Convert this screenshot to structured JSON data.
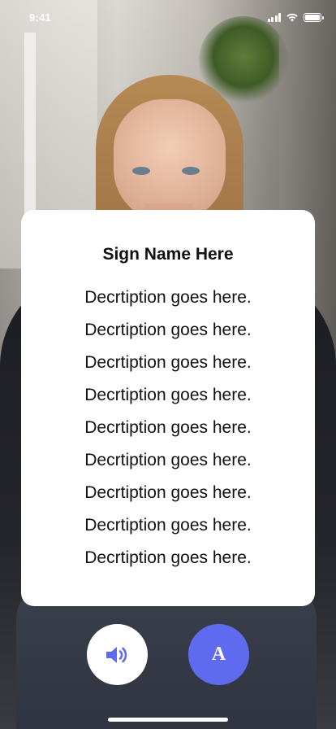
{
  "status_bar": {
    "time": "9:41"
  },
  "card": {
    "title": "Sign Name Here",
    "lines": [
      "Decrtiption goes here.",
      "Decrtiption goes here.",
      "Decrtiption goes here.",
      "Decrtiption goes here.",
      "Decrtiption goes here.",
      "Decrtiption goes here.",
      "Decrtiption goes here.",
      "Decrtiption goes here.",
      "Decrtiption goes here."
    ]
  },
  "buttons": {
    "sound_icon": "speaker-icon",
    "font_label": "A"
  },
  "colors": {
    "accent": "#5f6bef",
    "card_bg": "#ffffff"
  }
}
